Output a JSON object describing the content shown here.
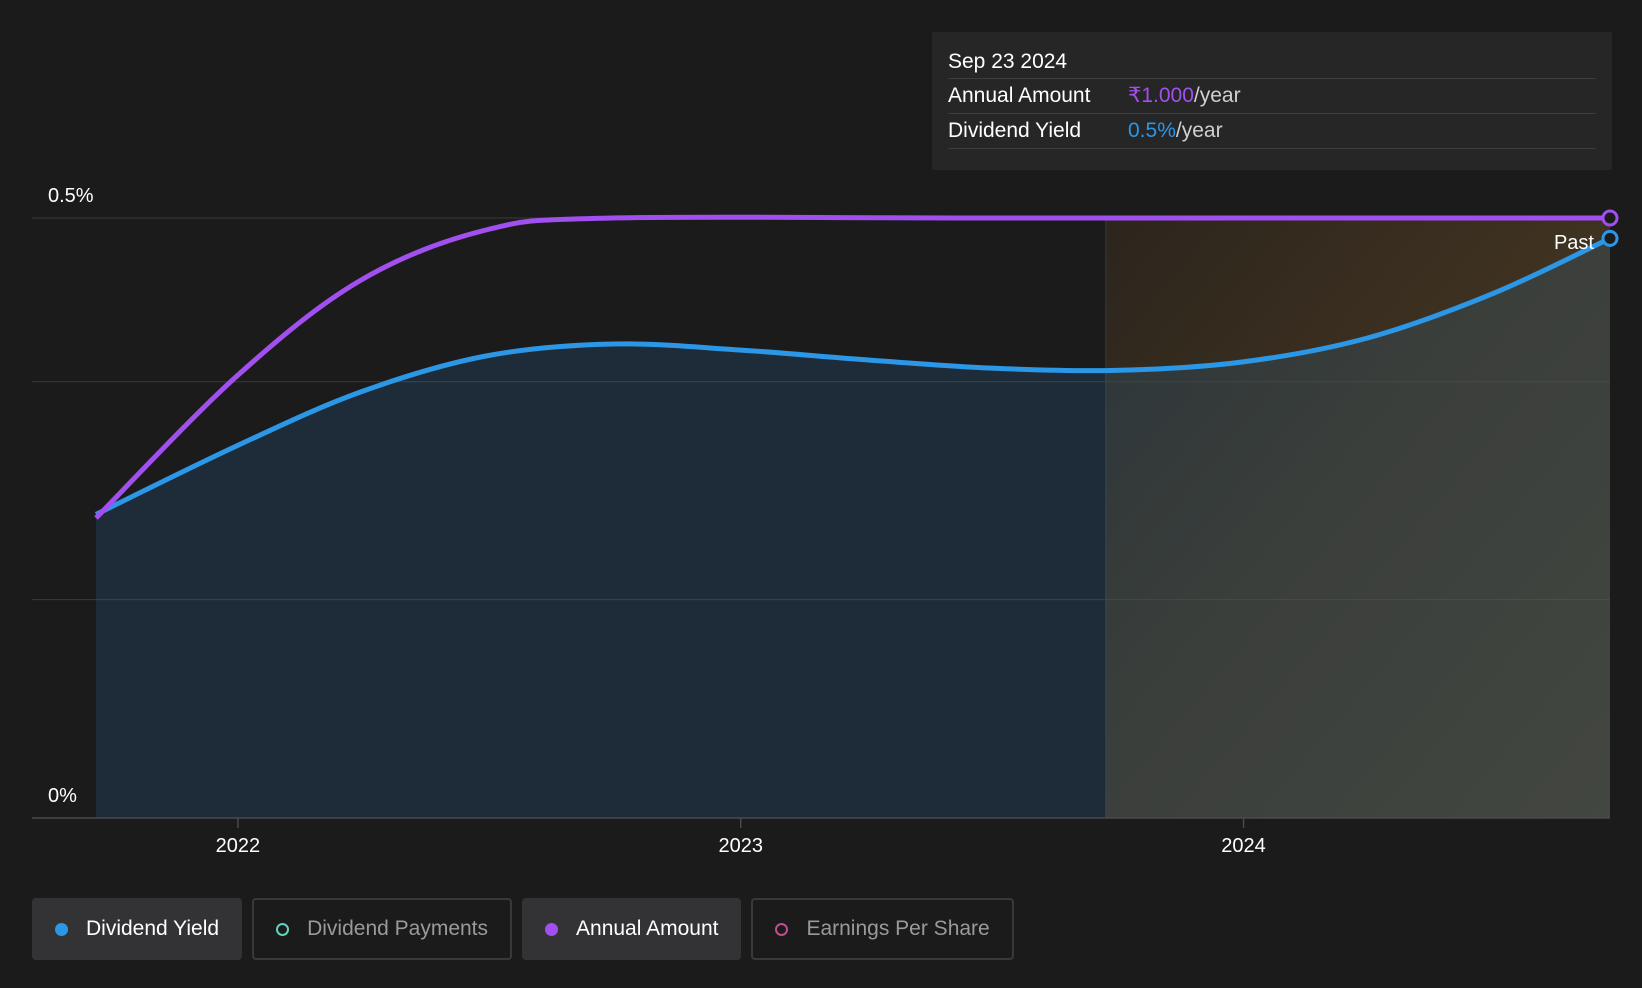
{
  "chart_data": {
    "type": "line",
    "x_ticks": [
      "2022",
      "2023",
      "2024"
    ],
    "y_ticks": [
      "0.5%",
      "0%"
    ],
    "forecast_label": "Past",
    "series": [
      {
        "name": "Dividend Yield",
        "color": "#2b97e6",
        "points": [
          [
            "2021-09-20",
            0.253
          ],
          [
            "2021-12-31",
            0.31
          ],
          [
            "2022-03-31",
            0.355
          ],
          [
            "2022-06-30",
            0.385
          ],
          [
            "2022-09-30",
            0.395
          ],
          [
            "2022-12-31",
            0.39
          ],
          [
            "2023-03-31",
            0.382
          ],
          [
            "2023-06-30",
            0.375
          ],
          [
            "2023-09-30",
            0.373
          ],
          [
            "2023-12-31",
            0.38
          ],
          [
            "2024-03-31",
            0.4
          ],
          [
            "2024-06-30",
            0.437
          ],
          [
            "2024-09-23",
            0.483
          ]
        ]
      },
      {
        "name": "Annual Amount",
        "color": "#a24ff0",
        "points": [
          [
            "2021-09-20",
            0.25
          ],
          [
            "2021-12-31",
            0.368
          ],
          [
            "2022-03-31",
            0.448
          ],
          [
            "2022-06-30",
            0.49
          ],
          [
            "2022-09-30",
            0.5
          ],
          [
            "2023-06-30",
            0.5
          ],
          [
            "2024-09-23",
            0.5
          ]
        ]
      }
    ],
    "ylim": [
      0,
      0.5
    ],
    "xlim": [
      "2021-09-20",
      "2024-09-23"
    ],
    "past_region_start": "2023-09-23",
    "grid": true
  },
  "tooltip": {
    "date": "Sep 23 2024",
    "rows": [
      {
        "label": "Annual Amount",
        "value": "₹1.000",
        "unit": "/year"
      },
      {
        "label": "Dividend Yield",
        "value": "0.5%",
        "unit": "/year"
      }
    ]
  },
  "legend": [
    {
      "label": "Dividend Yield",
      "color": "#2b97e6",
      "active": true,
      "filled": true
    },
    {
      "label": "Dividend Payments",
      "color": "#5fd3bf",
      "active": false,
      "filled": false
    },
    {
      "label": "Annual Amount",
      "color": "#a24ff0",
      "active": true,
      "filled": true
    },
    {
      "label": "Earnings Per Share",
      "color": "#c64b8c",
      "active": false,
      "filled": false
    }
  ]
}
